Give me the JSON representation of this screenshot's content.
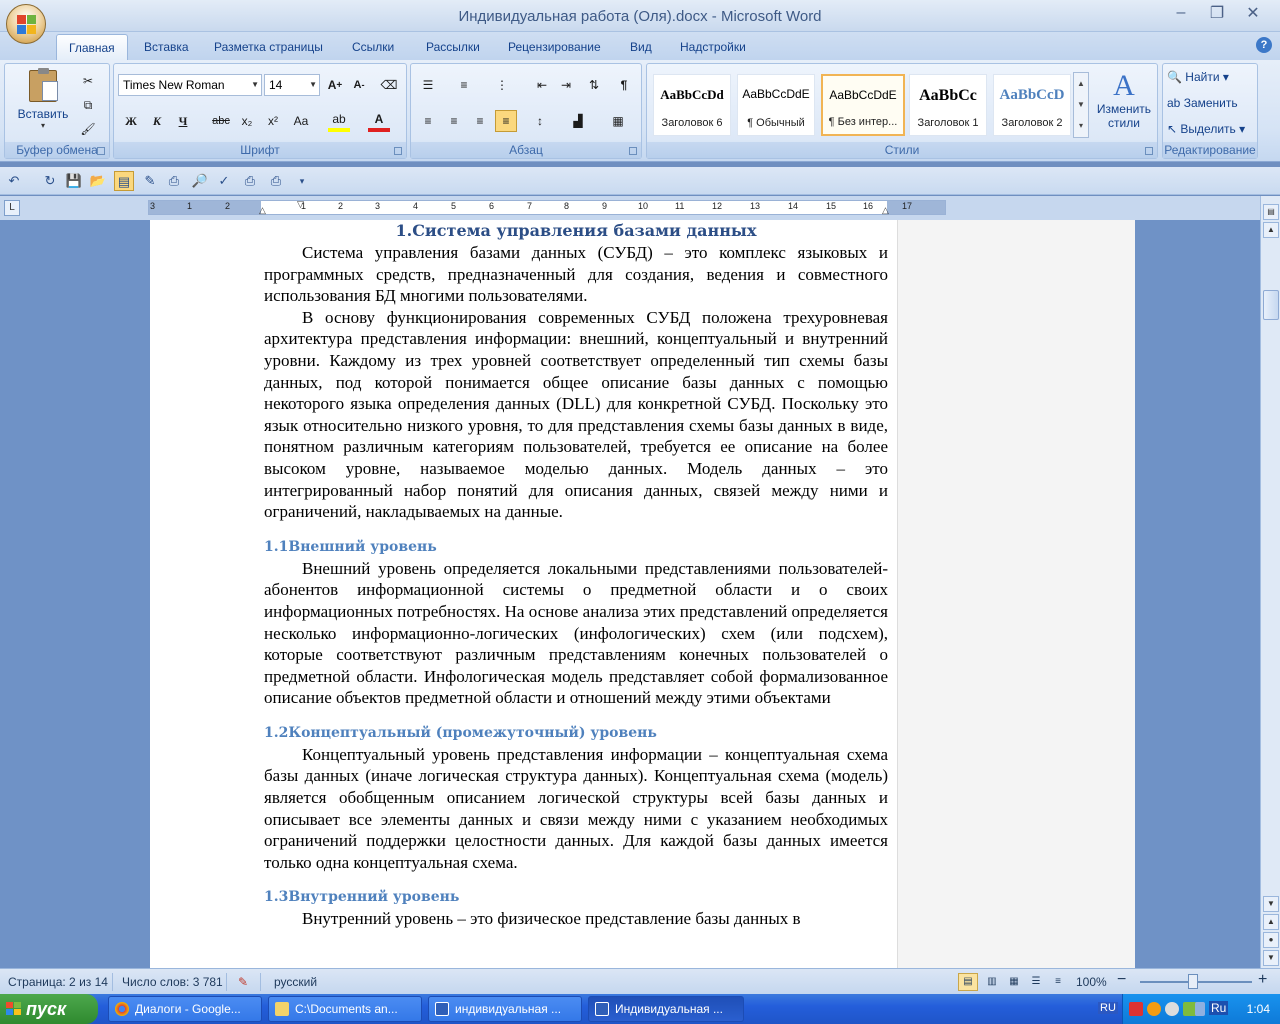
{
  "window": {
    "title": "Индивидуальная работа (Оля).docx - Microsoft Word",
    "controls": [
      "–",
      "❐",
      "✕"
    ],
    "doc_controls": [
      "–",
      "❐",
      "✕"
    ]
  },
  "tabs": [
    "Главная",
    "Вставка",
    "Разметка страницы",
    "Ссылки",
    "Рассылки",
    "Рецензирование",
    "Вид",
    "Надстройки"
  ],
  "ribbon": {
    "clipboard": {
      "label": "Буфер обмена",
      "paste": "Вставить"
    },
    "font": {
      "label": "Шрифт",
      "name": "Times New Roman",
      "size": "14",
      "bold": "Ж",
      "italic": "К",
      "underline": "Ч",
      "strike": "abc",
      "sub": "x₂",
      "sup": "x²",
      "case": "Aa"
    },
    "paragraph": {
      "label": "Абзац"
    },
    "styles": {
      "label": "Стили",
      "items": [
        {
          "sample": "AaBbCcDd",
          "name": "Заголовок 6"
        },
        {
          "sample": "AaBbCcDdE",
          "name": "¶ Обычный"
        },
        {
          "sample": "AaBbCcDdE",
          "name": "¶ Без интер..."
        },
        {
          "sample": "AaBbCc",
          "name": "Заголовок 1"
        },
        {
          "sample": "AaBbCcD",
          "name": "Заголовок 2"
        }
      ],
      "change_styles": "Изменить стили"
    },
    "editing": {
      "label": "Редактирование",
      "find": "Найти",
      "replace": "Заменить",
      "select": "Выделить"
    }
  },
  "ruler_ticks": [
    "3",
    "1",
    "2",
    "1",
    "1",
    "2",
    "3",
    "4",
    "5",
    "6",
    "7",
    "8",
    "9",
    "10",
    "11",
    "12",
    "13",
    "14",
    "15",
    "16",
    "17"
  ],
  "document": {
    "h1": "1.Система управления базами данных",
    "p1": "Система управления базами данных (СУБД) – это комплекс языковых и программных средств, предназначенный для создания, ведения и совместного использования БД многими пользователями.",
    "p2": "В основу функционирования современных СУБД положена трехуровневая архитектура представления информации: внешний, концептуальный и внутренний уровни. Каждому из трех уровней соответствует определенный тип схемы базы данных, под которой понимается общее описание базы данных с помощью некоторого языка определения данных (DLL) для конкретной СУБД. Поскольку это язык относительно низкого уровня, то для представления схемы базы данных в виде, понятном различным категориям пользователей, требуется ее описание на более высоком уровне, называемое моделью данных. Модель данных – это интегрированный набор понятий для описания данных, связей между ними и ограничений, накладываемых на данные.",
    "h2_1": "1.1Внешний уровень",
    "p3": "Внешний уровень определяется локальными представлениями пользователей-абонентов информационной системы о предметной области и о своих информационных потребностях. На основе анализа этих представлений определяется несколько информационно-логических (инфологических) схем (или подсхем), которые соответствуют различным представлениям конечных пользователей о предметной области. Инфологическая модель представляет собой формализованное описание объектов предметной области и отношений между этими объектами",
    "h2_2": "1.2Концептуальный (промежуточный) уровень",
    "p4": "Концептуальный уровень представления информации – концептуальная схема базы данных (иначе логическая структура данных). Концептуальная схема (модель) является обобщенным описанием логической структуры всей базы данных и описывает все элементы данных и связи между ними с указанием необходимых ограничений поддержки целостности данных. Для каждой базы данных имеется только одна концептуальная схема.",
    "h2_3": "1.3Внутренний уровень",
    "p5": "Внутренний уровень – это физическое представление базы данных в"
  },
  "status": {
    "page": "Страница: 2 из 14",
    "words": "Число слов: 3 781",
    "language": "русский",
    "zoom": "100%",
    "zoom_minus": "−",
    "zoom_plus": "+"
  },
  "taskbar": {
    "start": "пуск",
    "tasks": [
      "Диалоги - Google...",
      "C:\\Documents an...",
      "индивидуальная ...",
      "Индивидуальная ..."
    ],
    "lang": "RU",
    "lang2": "Ru",
    "clock": "1:04"
  }
}
